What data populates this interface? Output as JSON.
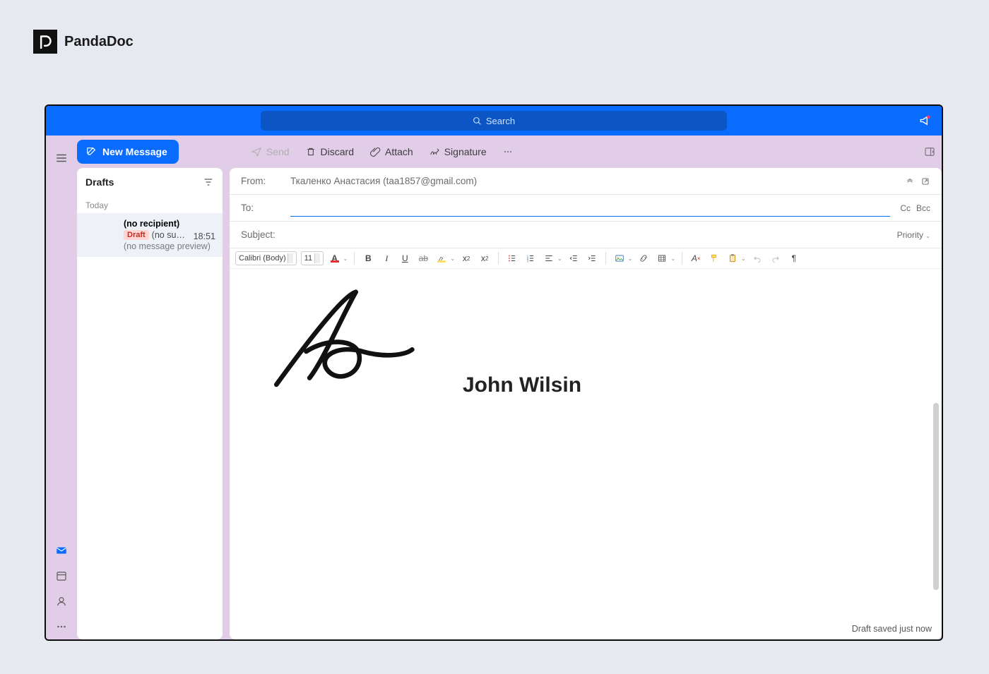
{
  "brand": {
    "name": "PandaDoc"
  },
  "titlebar": {
    "search_placeholder": "Search"
  },
  "toolbar": {
    "new_message": "New Message",
    "send": "Send",
    "discard": "Discard",
    "attach": "Attach",
    "signature": "Signature"
  },
  "folder": {
    "title": "Drafts",
    "group": "Today",
    "item": {
      "recipient": "(no recipient)",
      "badge": "Draft",
      "subject": "(no subj…",
      "time": "18:51",
      "preview": "(no message preview)"
    }
  },
  "compose": {
    "from_label": "From:",
    "from_value": "Ткаленко Анастасия (taa1857@gmail.com)",
    "to_label": "To:",
    "cc": "Cc",
    "bcc": "Bcc",
    "subject_label": "Subject:",
    "priority": "Priority",
    "font_name": "Calibri (Body)",
    "font_size": "11",
    "signature_name": "John Wilsin",
    "status": "Draft saved just now"
  }
}
